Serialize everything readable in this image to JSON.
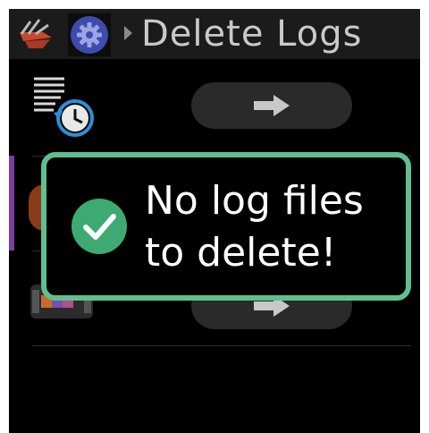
{
  "header": {
    "title": "Delete Logs",
    "icons": [
      "swiss-knife-icon",
      "gear-icon",
      "breadcrumb-chevron-icon"
    ]
  },
  "rows": [
    {
      "icon": "log-history-icon",
      "action": "arrow-right-icon"
    },
    {
      "icon": "color-palette-icon",
      "action": "arrow-right-icon"
    }
  ],
  "toast": {
    "line1": "No log files",
    "line2": "to delete!",
    "icon": "check-circle-icon",
    "border_color": "#5fbf8e"
  },
  "colors": {
    "background": "#000000",
    "titlebar": "#1b1b1b",
    "gear_badge": "#3f4cad",
    "selection_accent": "#7b3fa0"
  }
}
